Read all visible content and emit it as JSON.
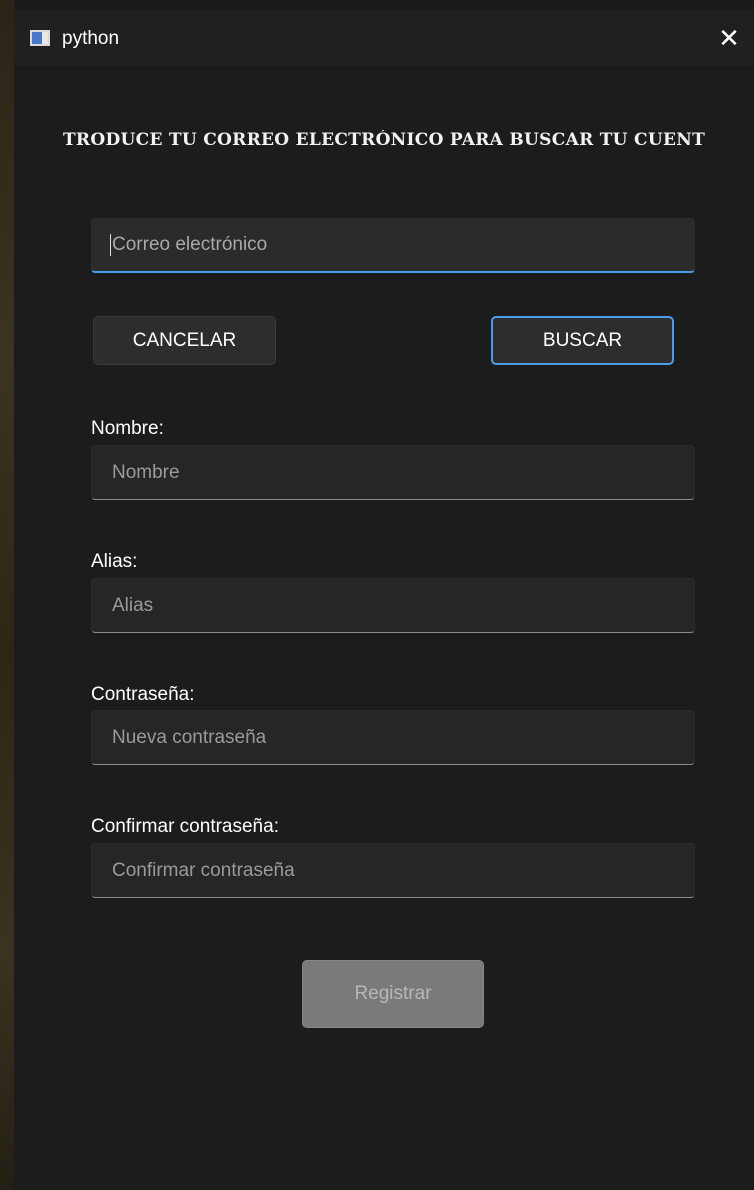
{
  "window": {
    "title": "python",
    "close_glyph": "✕",
    "icon": "python-window-icon"
  },
  "heading": "TRODUCE TU CORREO ELECTRÓNICO PARA BUSCAR TU CUENT",
  "email": {
    "placeholder": "Correo electrónico"
  },
  "buttons": {
    "cancel": "CANCELAR",
    "search": "BUSCAR",
    "register": "Registrar"
  },
  "form": {
    "name": {
      "label": "Nombre:",
      "placeholder": "Nombre"
    },
    "alias": {
      "label": "Alias:",
      "placeholder": "Alias"
    },
    "password": {
      "label": "Contraseña:",
      "placeholder": "Nueva contraseña"
    },
    "confirm": {
      "label": "Confirmar contraseña:",
      "placeholder": "Confirmar contraseña"
    }
  },
  "colors": {
    "accent": "#4c9be8",
    "background": "#1c1c1c",
    "titlebar": "#202020"
  }
}
